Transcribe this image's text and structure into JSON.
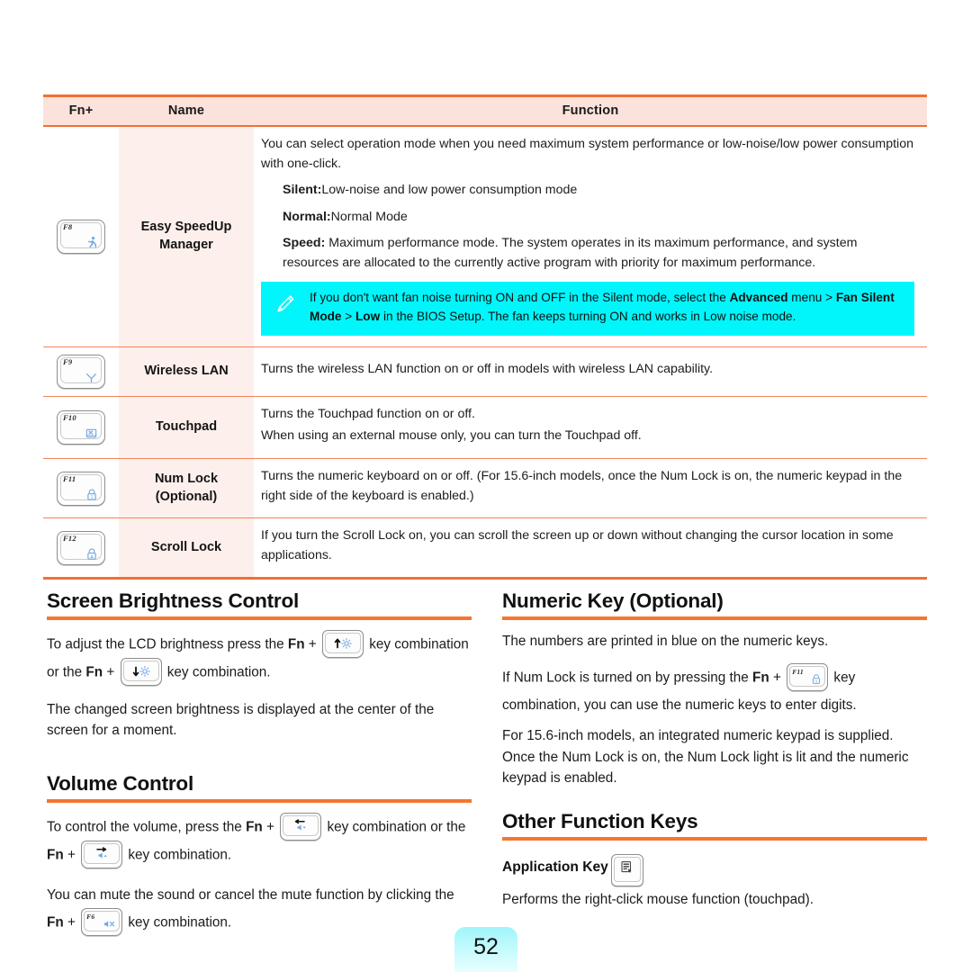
{
  "colors": {
    "accent_orange": "#f07134",
    "row_divider": "#f2845a",
    "header_bg": "#fbe2da",
    "name_col_bg": "#fdf0ec",
    "note_bg": "#00f6fb",
    "key_glyph_blue": "#6da8e8",
    "page_num_bg": "#9ff5fb"
  },
  "table": {
    "headers": {
      "key": "Fn+",
      "name": "Name",
      "function": "Function"
    },
    "rows": [
      {
        "key_label": "F8",
        "key_icon": "running-person-icon",
        "name": "Easy SpeedUp\nManager",
        "name_line1": "Easy SpeedUp",
        "name_line2": "Manager",
        "paragraphs": [
          {
            "indent": false,
            "parts": [
              {
                "text": "You can select operation mode when you need maximum system performance or low-noise/low power consumption with one-click.",
                "bold": false
              }
            ]
          },
          {
            "indent": true,
            "parts": [
              {
                "text": "Silent:",
                "bold": true
              },
              {
                "text": "Low-noise and low power consumption mode",
                "bold": false
              }
            ]
          },
          {
            "indent": true,
            "parts": [
              {
                "text": "Normal:",
                "bold": true
              },
              {
                "text": "Normal Mode",
                "bold": false
              }
            ]
          },
          {
            "indent": true,
            "parts": [
              {
                "text": "Speed:",
                "bold": true
              },
              {
                "text": " Maximum performance mode. The system operates in its maximum performance, and system resources are allocated to the currently active program with priority for maximum performance.",
                "bold": false
              }
            ]
          }
        ],
        "note": {
          "icon": "pencil-note-icon",
          "parts": [
            {
              "text": "If you don't want fan noise turning ON and OFF in the Silent mode, select the ",
              "bold": false
            },
            {
              "text": "Advanced",
              "bold": true
            },
            {
              "text": " menu > ",
              "bold": false
            },
            {
              "text": "Fan Silent Mode",
              "bold": true
            },
            {
              "text": " > ",
              "bold": false
            },
            {
              "text": "Low",
              "bold": true
            },
            {
              "text": " in the BIOS Setup. The fan keeps turning ON and works in Low noise mode.",
              "bold": false
            }
          ]
        }
      },
      {
        "key_label": "F9",
        "key_icon": "wireless-antenna-icon",
        "name_line1": "Wireless LAN",
        "name_line2": "",
        "paragraphs": [
          {
            "indent": false,
            "parts": [
              {
                "text": "Turns the wireless LAN function on or off in models with wireless LAN capability.",
                "bold": false
              }
            ]
          }
        ]
      },
      {
        "key_label": "F10",
        "key_icon": "touchpad-disabled-icon",
        "name_line1": "Touchpad",
        "name_line2": "",
        "paragraphs": [
          {
            "indent": false,
            "parts": [
              {
                "text": "Turns the Touchpad function on or off.",
                "bold": false
              }
            ]
          },
          {
            "indent": false,
            "parts": [
              {
                "text": "When using an external mouse only, you can turn the Touchpad off.",
                "bold": false
              }
            ]
          }
        ]
      },
      {
        "key_label": "F11",
        "key_icon": "num-lock-padlock-icon",
        "name_line1": "Num Lock",
        "name_line2": "(Optional)",
        "paragraphs": [
          {
            "indent": false,
            "parts": [
              {
                "text": "Turns the numeric keyboard on or off. (For 15.6-inch models, once the Num Lock is on, the numeric keypad in the right side of the keyboard is enabled.)",
                "bold": false
              }
            ]
          }
        ]
      },
      {
        "key_label": "F12",
        "key_icon": "scroll-lock-padlock-icon",
        "name_line1": "Scroll Lock",
        "name_line2": "",
        "paragraphs": [
          {
            "indent": false,
            "parts": [
              {
                "text": "If you turn the Scroll Lock on, you can scroll the screen up or down without changing the cursor location in some applications.",
                "bold": false
              }
            ]
          }
        ]
      }
    ]
  },
  "sections": {
    "screen_brightness": {
      "title": "Screen Brightness Control",
      "para1_a": "To adjust the LCD brightness press the ",
      "para1_fn": "Fn",
      "para1_plus": " + ",
      "para1_key1_icon": "brightness-up-key",
      "para1_b": " key combination or the ",
      "para1_fn2": "Fn",
      "para1_key2_icon": "brightness-down-key",
      "para1_c": " key combination.",
      "para2": "The changed screen brightness is displayed at the center of the screen for a moment."
    },
    "volume_control": {
      "title": "Volume Control",
      "para1_a": "To control the volume, press the ",
      "para1_fn": "Fn",
      "para1_key1_icon": "volume-down-key",
      "para1_b": " key combination or the ",
      "para1_key2_icon": "volume-up-key",
      "para1_c": " key combination.",
      "para2_a": "You can mute the sound or cancel the mute function by clicking the ",
      "para2_fn": "Fn",
      "para2_key_label": "F6",
      "para2_key_icon": "mute-speaker-key",
      "para2_b": " key combination."
    },
    "numeric_key": {
      "title": "Numeric Key (Optional)",
      "para1": "The numbers are printed in blue on the numeric keys.",
      "para2_a": "If Num Lock is turned on by pressing the ",
      "para2_fn": "Fn",
      "para2_key_label": "F11",
      "para2_key_icon": "num-lock-padlock-icon",
      "para2_b": " key combination, you can use the numeric keys to enter digits.",
      "para3": "For 15.6-inch models, an integrated numeric keypad is supplied. Once the Num Lock is on, the Num Lock light is lit and the numeric keypad is enabled."
    },
    "other_function_keys": {
      "title": "Other Function Keys",
      "app_key_label": "Application Key",
      "app_key_icon": "application-menu-key",
      "app_key_desc": "Performs the right-click mouse function (touchpad)."
    }
  },
  "footer": {
    "page_number": "52"
  }
}
